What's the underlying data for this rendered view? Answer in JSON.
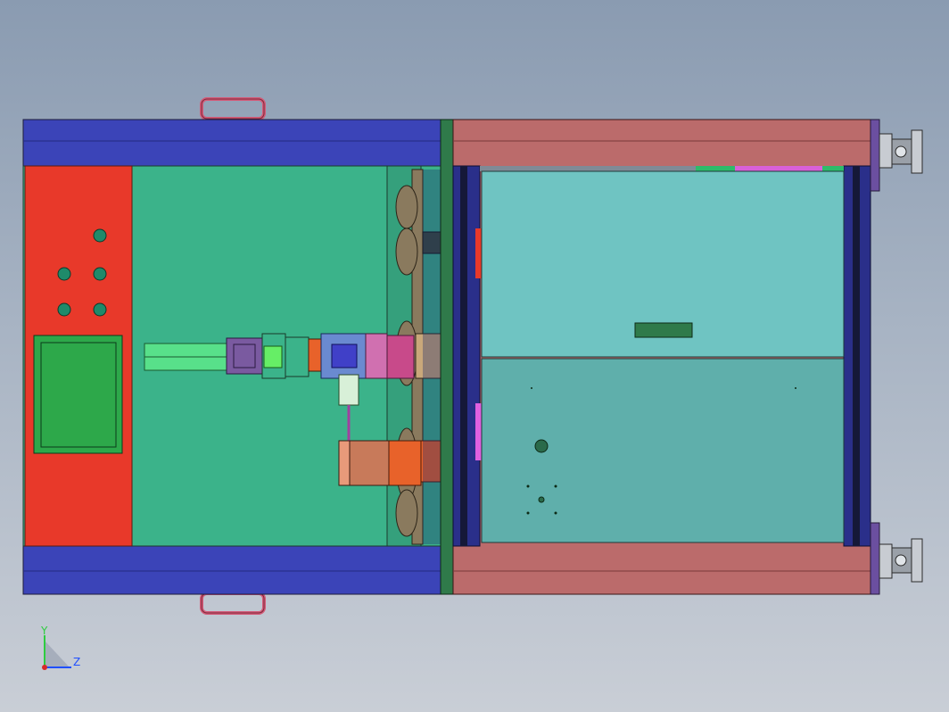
{
  "viewport": {
    "background_top": "#8a9bb1",
    "background_bottom": "#c9ced6"
  },
  "axis_triad": {
    "y_label": "Y",
    "z_label": "Z",
    "y_color": "#2ecc40",
    "z_color": "#1f4fff",
    "x_color": "#d62a2a"
  },
  "colors": {
    "frame_blue": "#3b44b8",
    "control_panel_red": "#e8392a",
    "green_plate": "#3bb38a",
    "screen_green": "#2da84a",
    "rose_frame": "#bb6b6b",
    "teal_top": "#6fc4c2",
    "teal_bottom": "#5fafab",
    "handle": "#d45a78",
    "mount": "#6b4fa0"
  },
  "control_panel": {
    "buttons": 5,
    "screen_count": 1
  }
}
